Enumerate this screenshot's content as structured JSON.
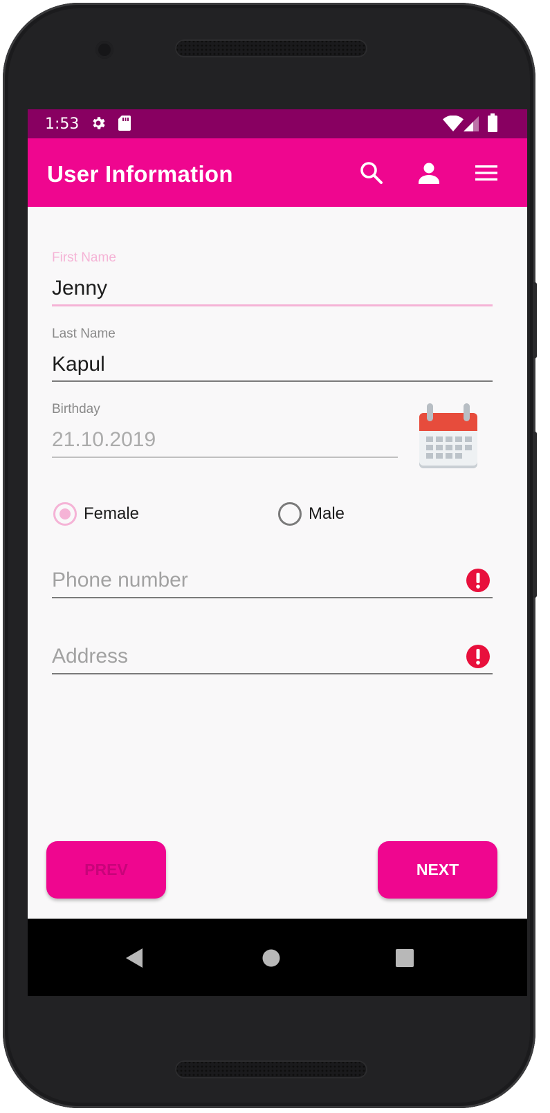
{
  "status_bar": {
    "time": "1:53",
    "icons": [
      "gear-icon",
      "sd-card-icon",
      "wifi-icon",
      "signal-icon",
      "battery-icon"
    ]
  },
  "app_bar": {
    "title": "User Information",
    "actions": [
      "search-icon",
      "account-icon",
      "menu-icon"
    ]
  },
  "form": {
    "first_name": {
      "label": "First Name",
      "value": "Jenny"
    },
    "last_name": {
      "label": "Last Name",
      "value": "Kapul"
    },
    "birthday": {
      "label": "Birthday",
      "value": "21.10.2019"
    },
    "gender": {
      "options": [
        {
          "label": "Female",
          "selected": true
        },
        {
          "label": "Male",
          "selected": false
        }
      ]
    },
    "phone": {
      "placeholder": "Phone number",
      "error": true
    },
    "address": {
      "placeholder": "Address",
      "error": true
    }
  },
  "buttons": {
    "prev": "PREV",
    "next": "NEXT"
  },
  "colors": {
    "primary": "#ef068f",
    "primary_dark": "#880061",
    "accent_light": "#f5b3d6",
    "error": "#e8103c",
    "prev_text_disabled": "#c8047a"
  }
}
